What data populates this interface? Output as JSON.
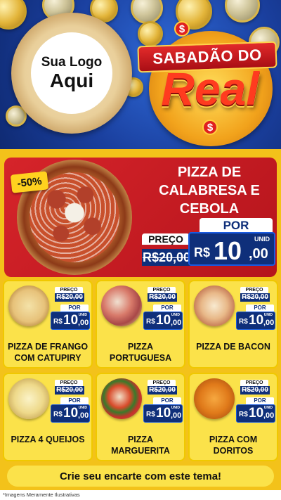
{
  "header": {
    "logo_line1": "Sua Logo",
    "logo_line2": "Aqui",
    "badge_top": "SABADÃO DO",
    "badge_bottom": "Real",
    "dollar_sign": "$"
  },
  "main_offer": {
    "discount": "-50%",
    "title": "PIZZA DE CALABRESA E CEBOLA",
    "price_label": "PREÇO",
    "old_price": "R$20,00",
    "por_label": "POR",
    "currency": "R$",
    "new_price_int": "10",
    "new_price_cents": ",00",
    "unit": "UNID"
  },
  "products": [
    {
      "name": "PIZZA DE FRANGO COM CATUPIRY",
      "price_label": "PREÇO",
      "old_price": "R$20,00",
      "por_label": "POR",
      "currency": "R$",
      "price_int": "10",
      "price_cents": ",00",
      "unit": "UNID"
    },
    {
      "name": "PIZZA PORTUGUESA",
      "price_label": "PREÇO",
      "old_price": "R$20,00",
      "por_label": "POR",
      "currency": "R$",
      "price_int": "10",
      "price_cents": ",00",
      "unit": "UNID"
    },
    {
      "name": "PIZZA DE BACON",
      "price_label": "PREÇO",
      "old_price": "R$20,00",
      "por_label": "POR",
      "currency": "R$",
      "price_int": "10",
      "price_cents": ",00",
      "unit": "UNID"
    },
    {
      "name": "PIZZA 4 QUEIJOS",
      "price_label": "PREÇO",
      "old_price": "R$20,00",
      "por_label": "POR",
      "currency": "R$",
      "price_int": "10",
      "price_cents": ",00",
      "unit": "UNID"
    },
    {
      "name": "PIZZA MARGUERITA",
      "price_label": "PREÇO",
      "old_price": "R$20,00",
      "por_label": "POR",
      "currency": "R$",
      "price_int": "10",
      "price_cents": ",00",
      "unit": "UNID"
    },
    {
      "name": "PIZZA COM DORITOS",
      "price_label": "PREÇO",
      "old_price": "R$20,00",
      "por_label": "POR",
      "currency": "R$",
      "price_int": "10",
      "price_cents": ",00",
      "unit": "UNID"
    }
  ],
  "footer": {
    "cta": "Crie seu encarte com este tema!",
    "disclaimer": "*Imagens Meramente Ilustrativas"
  },
  "colors": {
    "background_yellow": "#f3c21a",
    "header_blue": "#1a3f9e",
    "offer_red": "#d6242a",
    "price_navy": "#0f2f7a",
    "card_yellow": "#fbe24a"
  }
}
